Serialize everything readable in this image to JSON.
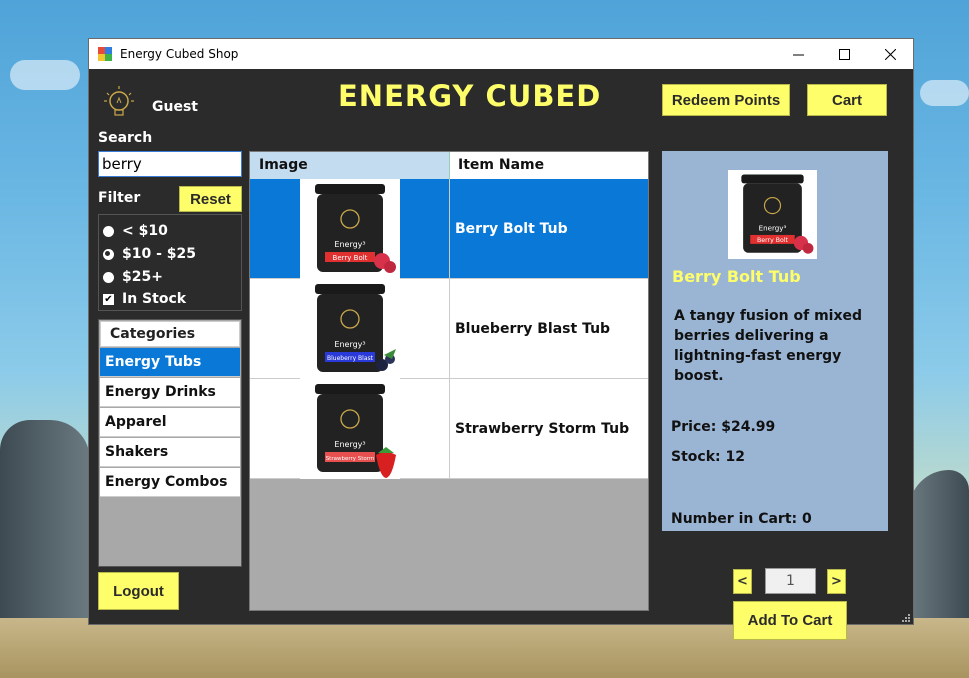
{
  "window": {
    "title": "Energy Cubed Shop"
  },
  "header": {
    "user": "Guest",
    "app_title": "ENERGY CUBED",
    "redeem_label": "Redeem Points",
    "cart_label": "Cart"
  },
  "search": {
    "label": "Search",
    "value": "berry"
  },
  "filter": {
    "label": "Filter",
    "reset_label": "Reset",
    "options": [
      "< $10",
      "$10 - $25",
      "$25+"
    ],
    "in_stock_label": "In Stock"
  },
  "categories": {
    "header": "Categories",
    "items": [
      "Energy Tubs",
      "Energy Drinks",
      "Apparel",
      "Shakers",
      "Energy Combos"
    ],
    "selected": "Energy Tubs"
  },
  "grid": {
    "columns": [
      "Image",
      "Item Name"
    ],
    "rows": [
      {
        "name": "Berry Bolt Tub",
        "label": "Berry Bolt",
        "label_color": "#e03030"
      },
      {
        "name": "Blueberry Blast Tub",
        "label": "Blueberry Blast",
        "label_color": "#2a3ad8"
      },
      {
        "name": "Strawberry Storm Tub",
        "label": "Strawberry Storm",
        "label_color": "#e85050"
      }
    ]
  },
  "detail": {
    "name": "Berry Bolt Tub",
    "description": "A tangy fusion of mixed berries delivering a lightning-fast energy boost.",
    "price": "Price: $24.99",
    "stock": "Stock: 12",
    "in_cart": "Number in Cart: 0",
    "tub_label": "Berry Bolt",
    "tub_brand": "Energy³"
  },
  "quantity": {
    "dec": "<",
    "value": "1",
    "inc": ">"
  },
  "actions": {
    "add_to_cart": "Add To Cart",
    "logout": "Logout"
  },
  "tub_brand": "Energy³",
  "colors": {
    "accent_yellow": "#fefe6a",
    "selection_blue": "#0a78d7",
    "panel_dark": "#2b2b2b",
    "detail_bg": "#9ab4d4"
  }
}
